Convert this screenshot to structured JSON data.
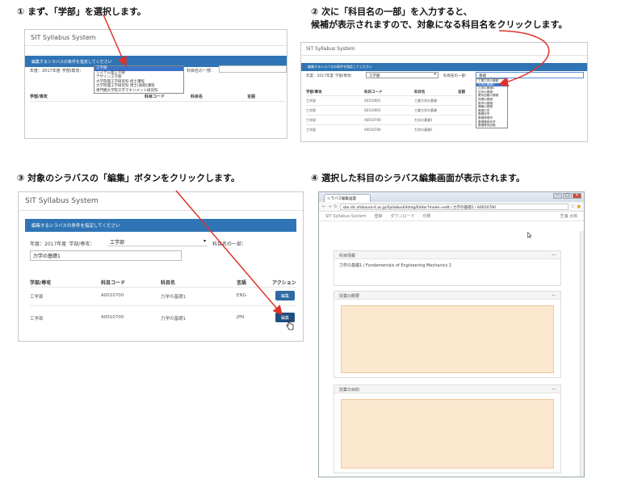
{
  "steps": {
    "s1": "① まず、「学部」を選択します。",
    "s2_line1": "② 次に「科目名の一部」を入力すると、",
    "s2_line2": "候補が表示されますので、対象になる科目名をクリックします。",
    "s3": "③ 対象のシラバスの「編集」ボタンをクリックします。",
    "s4": "④ 選択した科目のシラバス編集画面が表示されます。"
  },
  "app": {
    "title": "SIT Syllabus System",
    "banner": "編集するシラバスの条件を指定してください",
    "filter_year": "年度：2017年度",
    "filter_dept_label": "学部/専攻：",
    "filter_dept_value": "工学部",
    "filter_subject_label": "科目名の一部：",
    "subject_input_value": "力学の基礎1"
  },
  "dropdown1": {
    "options": [
      "工学部",
      "システム理工学部",
      "デザイン工学部",
      "大学院理工学研究科 修士課程",
      "大学院理工学研究科 博士(後期)課程",
      "専門職大学院工学マネジメント研究科"
    ],
    "selected_index": 0
  },
  "dropdown2": {
    "input_value": "基礎",
    "options": [
      "工業力学の基礎",
      "力学の基礎1",
      "力学の基礎2",
      "化学の基礎",
      "電気回路の基礎",
      "物理の基礎",
      "数学の基礎",
      "情報の基礎",
      "基礎力学",
      "基礎化学",
      "基礎物理学",
      "基礎電磁気学",
      "基礎電気回路"
    ],
    "selected_index": 1
  },
  "table": {
    "headers": [
      "学部/専攻",
      "科目コード",
      "科目名",
      "言語",
      "アクション"
    ],
    "rows": [
      {
        "dept": "工学部",
        "code": "A0010700",
        "name": "力学の基礎1",
        "lang": "ENG"
      },
      {
        "dept": "工学部",
        "code": "A0010700",
        "name": "力学の基礎1",
        "lang": "JPN"
      }
    ],
    "edit_label": "編集"
  },
  "table2": {
    "headers": [
      "学部/専攻",
      "科目コード",
      "科目名",
      "言語"
    ],
    "rows": [
      {
        "dept": "工学部",
        "code": "S0110001",
        "name": "工業力学の基礎"
      },
      {
        "dept": "工学部",
        "code": "S0110002",
        "name": "工業力学の基礎"
      },
      {
        "dept": "工学部",
        "code": "A0010700",
        "name": "力学の基礎1"
      },
      {
        "dept": "工学部",
        "code": "A0010700",
        "name": "力学の基礎1"
      }
    ]
  },
  "table1": {
    "headers": [
      "学部/専攻",
      "科目コード",
      "科目名",
      "言語"
    ]
  },
  "browser": {
    "tab_label": "シラバス編集画面",
    "url": "sbx.dic.shibaura-it.ac.jp/SyllabusEditing/Editor?mode=edit / 力学の基礎1 / A0010700",
    "menu_items": [
      "SIT Syllabus System",
      "登録",
      "ダウンロード",
      "印刷"
    ],
    "user_label": "芝浦 太郎",
    "panel1_title": "科目情報",
    "panel1_body": "力学の基礎1 / Fundamentals of Engineering Mechanics 1",
    "panel2_title": "授業の概要",
    "panel3_title": "授業の目的"
  },
  "colors": {
    "accent": "#2f75b5",
    "arrow": "#e0312a",
    "textarea": "#fce7cf"
  }
}
